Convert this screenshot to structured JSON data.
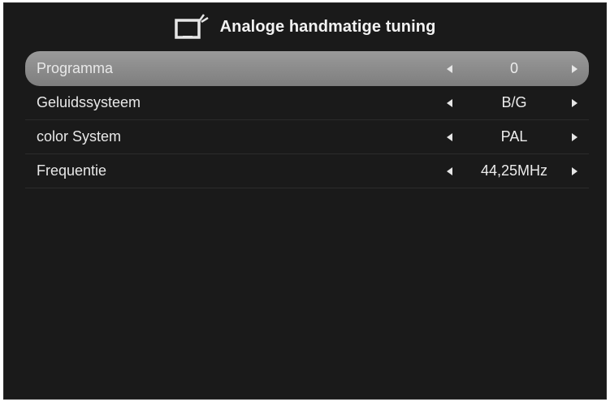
{
  "header": {
    "icon": "tv-icon",
    "title": "Analoge handmatige tuning"
  },
  "menu": {
    "items": [
      {
        "label": "Programma",
        "value": "0",
        "selected": true
      },
      {
        "label": "Geluidssysteem",
        "value": "B/G",
        "selected": false
      },
      {
        "label": "color System",
        "value": "PAL",
        "selected": false
      },
      {
        "label": "Frequentie",
        "value": "44,25MHz",
        "selected": false
      }
    ]
  },
  "colors": {
    "background": "#1a1a1a",
    "selected_row": "#8c8c8c",
    "text": "#e8e8e8"
  }
}
